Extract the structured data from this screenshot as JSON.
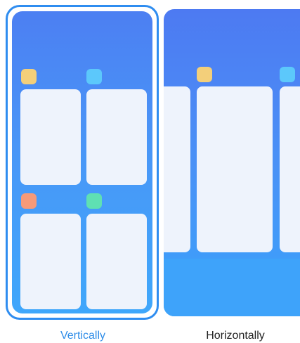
{
  "options": [
    {
      "id": "vertical",
      "label": "Vertically",
      "selected": true
    },
    {
      "id": "horizontal",
      "label": "Horizontally",
      "selected": false
    }
  ],
  "colors": {
    "selected_accent": "#2f8df0",
    "selected_label": "#2f8de8",
    "unselected_label": "#222222",
    "phone_background_top": "#4c7ff2",
    "phone_background_bottom": "#3fa7fb",
    "card": "#eef3fc",
    "icon_yellow": "#f3cf7a",
    "icon_cyan": "#5cc8fb",
    "icon_orange": "#f69a78",
    "icon_green": "#5fe0b3"
  }
}
